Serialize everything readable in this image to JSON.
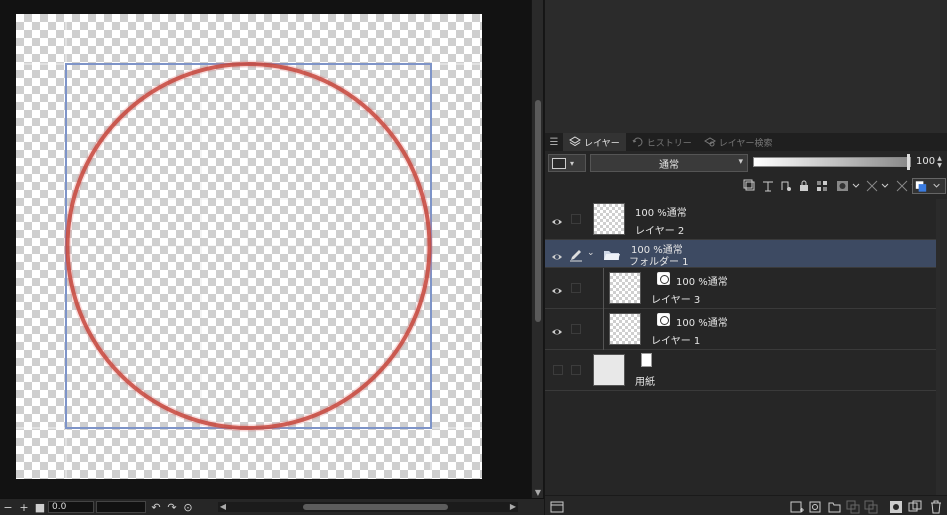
{
  "canvas": {
    "zoom_value": "0.0"
  },
  "panel": {
    "tabs": [
      {
        "label": "レイヤー",
        "icon": "layers-icon"
      },
      {
        "label": "ヒストリー",
        "icon": "history-icon"
      },
      {
        "label": "レイヤー検索",
        "icon": "layer-search-icon"
      }
    ],
    "blend_mode": "通常",
    "opacity": "100",
    "layers": [
      {
        "mode": "100 %通常",
        "name": "レイヤー 2",
        "type": "raster"
      },
      {
        "mode": "100 %通常",
        "name": "フォルダー 1",
        "type": "folder"
      },
      {
        "mode": "100 %通常",
        "name": "レイヤー 3",
        "type": "raster-child"
      },
      {
        "mode": "100 %通常",
        "name": "レイヤー 1",
        "type": "raster-child"
      },
      {
        "mode": "",
        "name": "用紙",
        "type": "paper"
      }
    ]
  },
  "colors": {
    "selected_row": "#3d4a62",
    "circle_stroke": "#c0392b",
    "guide_box": "#7e94c8"
  }
}
